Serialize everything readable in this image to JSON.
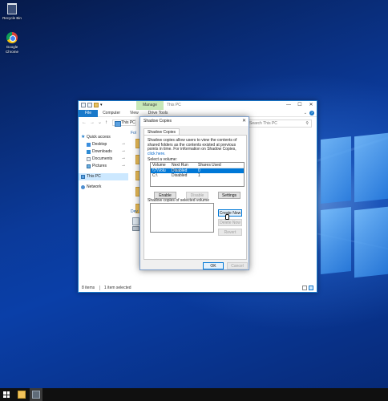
{
  "desktop": {
    "icons": [
      {
        "label": "Recycle Bin",
        "icon": "recycle-bin-icon"
      },
      {
        "label": "Google Chrome",
        "icon": "chrome-icon"
      }
    ]
  },
  "explorer": {
    "title": "This PC",
    "manage_tab": "Manage",
    "drive_tools": "Drive Tools",
    "ribbon_tabs": [
      "File",
      "Computer",
      "View"
    ],
    "address": "This PC",
    "search_placeholder": "Search This PC",
    "sidebar": {
      "quick_access": "Quick access",
      "items": [
        "Desktop",
        "Downloads",
        "Documents",
        "Pictures"
      ],
      "this_pc": "This PC",
      "network": "Network"
    },
    "content_fragments": {
      "folders": "Fol",
      "devices": "Dev"
    },
    "status": {
      "items": "8 items",
      "selected": "1 item selected"
    }
  },
  "dialog": {
    "title": "Shadow Copies",
    "tab": "Shadow Copies",
    "description": "Shadow copies allow users to view the contents of shared folders as the contents existed at previous points in time. For information on Shadow Copies, ",
    "link": "click here.",
    "select_volume_label": "Select a volume:",
    "columns": [
      "Volume",
      "Next Run Time",
      "Shares",
      "Used"
    ],
    "rows": [
      {
        "volume": "\\\\?\\Volu",
        "next_run": "Disabled",
        "shares": "0",
        "used": ""
      },
      {
        "volume": "C:\\",
        "next_run": "Disabled",
        "shares": "1",
        "used": ""
      }
    ],
    "buttons": {
      "enable": "Enable",
      "disable": "Disable",
      "settings": "Settings",
      "create_now": "Create Now",
      "delete_now": "Delete Now",
      "revert": "Revert",
      "ok": "OK",
      "cancel": "Cancel"
    },
    "copies_label": "Shadow copies of selected volume"
  }
}
